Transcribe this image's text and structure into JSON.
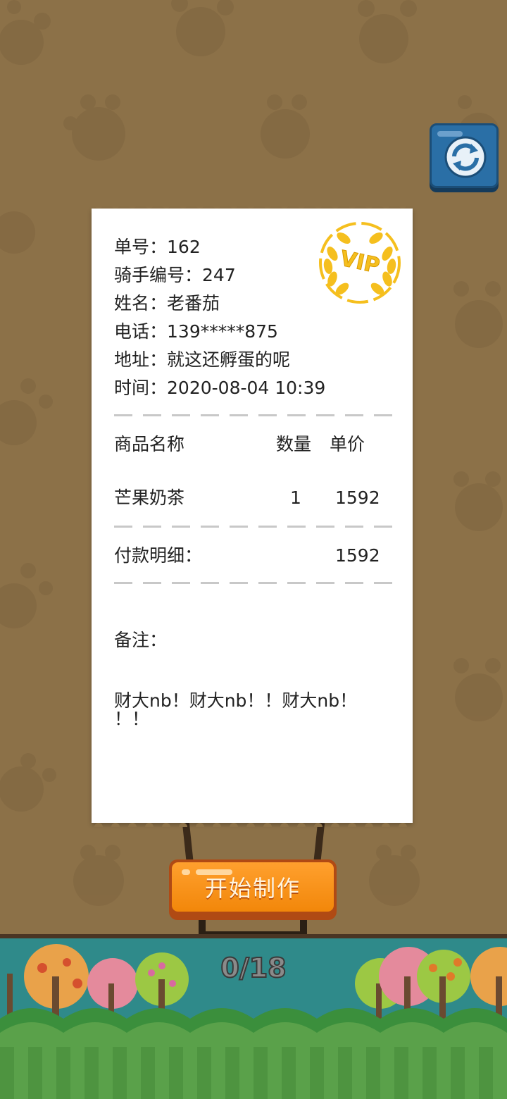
{
  "order": {
    "number_label": "单号：",
    "number": "162",
    "rider_label": "骑手编号：",
    "rider": "247",
    "name_label": "姓名：",
    "name": "老番茄",
    "phone_label": "电话：",
    "phone": "139*****875",
    "address_label": "地址：",
    "address": "就这还孵蛋的呢",
    "time_label": "时间：",
    "time": "2020-08-04 10:39"
  },
  "items_header": {
    "product": "商品名称",
    "qty": "数量",
    "price": "单价"
  },
  "items": [
    {
      "product": "芒果奶茶",
      "qty": "1",
      "price": "1592"
    }
  ],
  "payment": {
    "label": "付款明细：",
    "total": "1592"
  },
  "notes": {
    "label": "备注：",
    "line1": "财大nb！财大nb！！财大nb！",
    "line2": "！！"
  },
  "badge": {
    "text": "VIP",
    "color": "#f5bf1e"
  },
  "start_button": {
    "label": "开始制作"
  },
  "progress": {
    "text": "0/18"
  },
  "icons": {
    "refresh": "refresh-icon"
  },
  "colors": {
    "background": "#8c7148",
    "button_orange": "#f2870a",
    "button_blue": "#2a6fa6"
  }
}
